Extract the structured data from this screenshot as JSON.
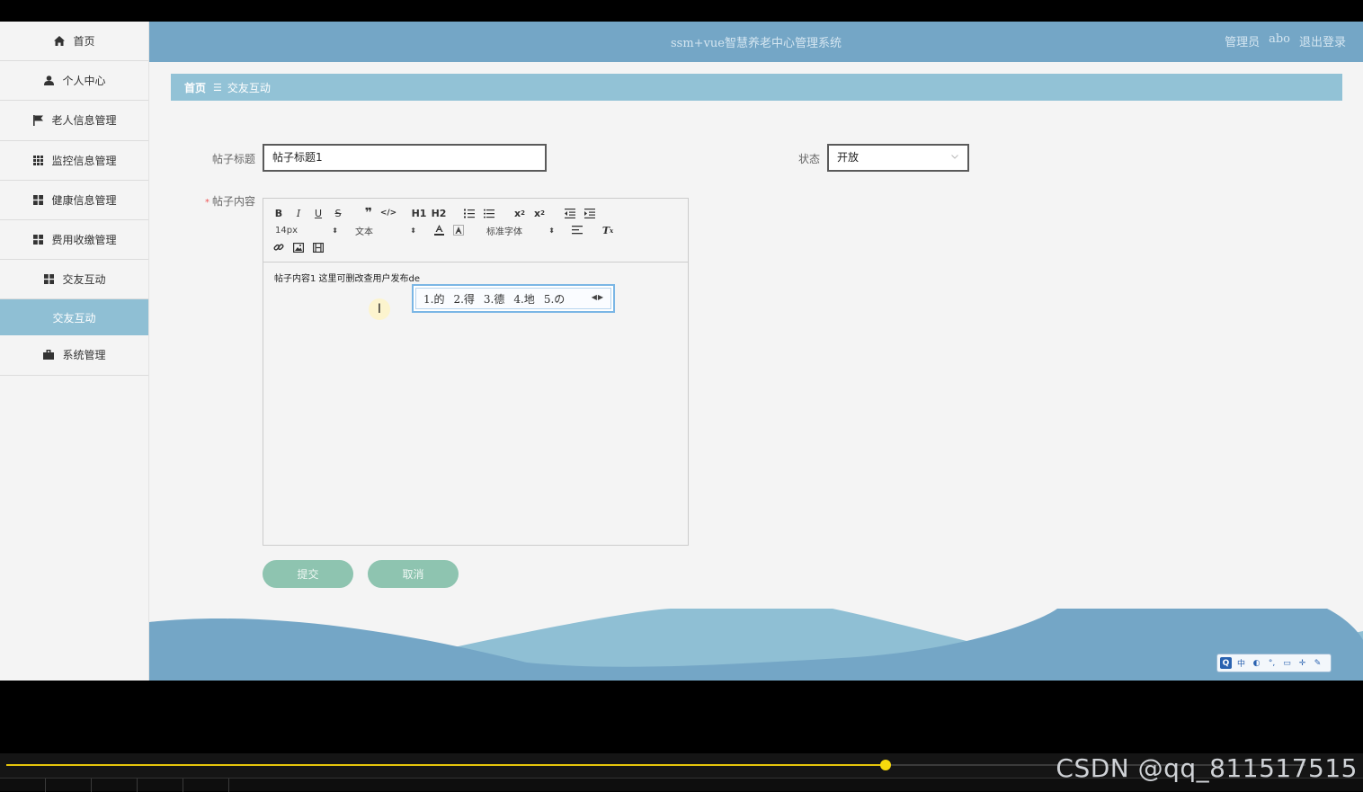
{
  "app": {
    "title": "ssm+vue智慧养老中心管理系统",
    "role": "管理员",
    "user": "abo",
    "logout": "退出登录"
  },
  "sidebar": {
    "items": [
      {
        "label": "首页",
        "icon": "home-icon"
      },
      {
        "label": "个人中心",
        "icon": "user-icon"
      },
      {
        "label": "老人信息管理",
        "icon": "flag-icon"
      },
      {
        "label": "监控信息管理",
        "icon": "grid-icon"
      },
      {
        "label": "健康信息管理",
        "icon": "apps-icon"
      },
      {
        "label": "费用收缴管理",
        "icon": "apps-icon"
      },
      {
        "label": "交友互动",
        "icon": "apps-icon"
      },
      {
        "label": "交友互动",
        "icon": "",
        "active": true
      },
      {
        "label": "系统管理",
        "icon": "briefcase-icon"
      }
    ]
  },
  "breadcrumb": {
    "home": "首页",
    "separator": "☰",
    "current": "交友互动"
  },
  "form": {
    "title_label": "帖子标题",
    "title_value": "帖子标题1",
    "status_label": "状态",
    "status_value": "开放",
    "content_label": "帖子内容",
    "required_mark": "*",
    "content_text": "帖子内容1 这里可删改查用户发布de"
  },
  "editor_toolbar": {
    "font_size": "14px",
    "heading": "文本",
    "font_family": "标准字体",
    "h1": "H1",
    "h2": "H2"
  },
  "ime": {
    "candidates": [
      "1.的",
      "2.得",
      "3.德",
      "4.地",
      "5.の"
    ],
    "toolbar": [
      "Q",
      "中",
      "◐",
      "°,",
      "▭",
      "✛",
      "✎"
    ]
  },
  "buttons": {
    "submit": "提交",
    "cancel": "取消"
  },
  "player": {
    "progress": 0.677,
    "watermark": "CSDN @qq_811517515"
  },
  "colors": {
    "header": "#74a6c6",
    "breadcrumb": "#92c2d6",
    "sidebar_active": "#8fbfd4",
    "button": "#8ec4b0",
    "progress": "#e6c50b"
  }
}
